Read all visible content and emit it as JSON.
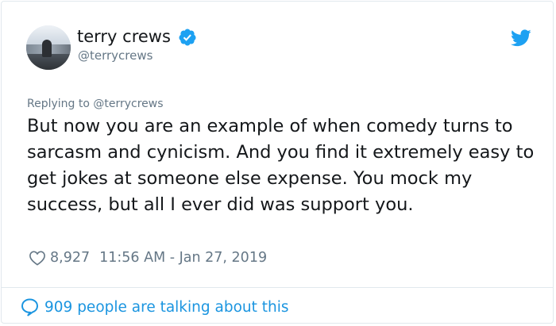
{
  "author": {
    "display_name": "terry crews",
    "handle": "@terrycrews",
    "verified_icon": "verified-badge-icon",
    "avatar": "profile-photo"
  },
  "brand_icon": "twitter-bird-icon",
  "tweet": {
    "replying_to": "Replying to @terrycrews",
    "text": "But now you are an example of when comedy turns to sarcasm and cynicism. And you find it extremely easy to get jokes at someone else expense. You mock my success, but all I ever did was support you.",
    "likes": "8,927",
    "timestamp": "11:56 AM - Jan 27, 2019"
  },
  "footer": {
    "talking_text": "909 people are talking about this",
    "talking_icon": "speech-bubble-icon"
  },
  "colors": {
    "accent": "#1da1f2",
    "link": "#1b95e0",
    "secondary_text": "#657786",
    "primary_text": "#14171a",
    "border": "#e1e8ed"
  }
}
